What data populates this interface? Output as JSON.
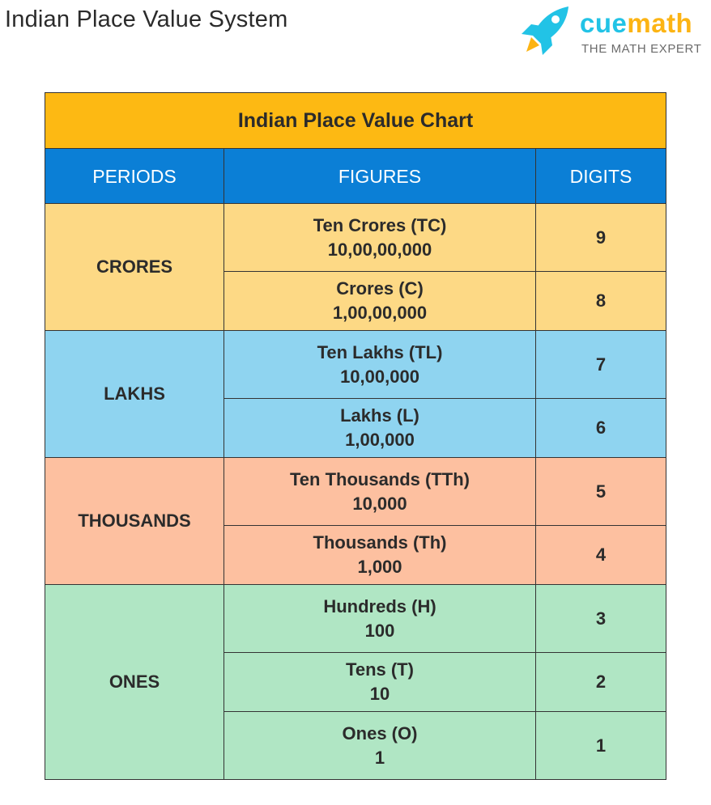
{
  "page": {
    "title": "Indian Place Value System"
  },
  "logo": {
    "icon": "rocket-icon",
    "brand_part1": "cue",
    "brand_part2": "math",
    "tagline": "THE MATH EXPERT",
    "colors": {
      "cue": "#22c3e6",
      "math": "#fcb414",
      "rocket_body": "#22c3e6",
      "rocket_flame": "#fcb414"
    }
  },
  "table": {
    "title": "Indian Place Value Chart",
    "headers": [
      "PERIODS",
      "FIGURES",
      "DIGITS"
    ],
    "colors": {
      "title_bg": "#fdb913",
      "header_bg": "#0b7fd6",
      "crores_bg": "#fdd985",
      "lakhs_bg": "#8fd4f0",
      "thousands_bg": "#fdc0a0",
      "ones_bg": "#b0e6c4"
    },
    "periods": [
      {
        "name": "CRORES",
        "rows": [
          {
            "figure": "Ten Crores (TC)",
            "value": "10,00,00,000",
            "digits": "9"
          },
          {
            "figure": "Crores (C)",
            "value": "1,00,00,000",
            "digits": "8"
          }
        ]
      },
      {
        "name": "LAKHS",
        "rows": [
          {
            "figure": "Ten Lakhs (TL)",
            "value": "10,00,000",
            "digits": "7"
          },
          {
            "figure": "Lakhs (L)",
            "value": "1,00,000",
            "digits": "6"
          }
        ]
      },
      {
        "name": "THOUSANDS",
        "rows": [
          {
            "figure": "Ten Thousands (TTh)",
            "value": "10,000",
            "digits": "5"
          },
          {
            "figure": "Thousands (Th)",
            "value": "1,000",
            "digits": "4"
          }
        ]
      },
      {
        "name": "ONES",
        "rows": [
          {
            "figure": "Hundreds (H)",
            "value": "100",
            "digits": "3"
          },
          {
            "figure": "Tens (T)",
            "value": "10",
            "digits": "2"
          },
          {
            "figure": "Ones (O)",
            "value": "1",
            "digits": "1"
          }
        ]
      }
    ]
  }
}
